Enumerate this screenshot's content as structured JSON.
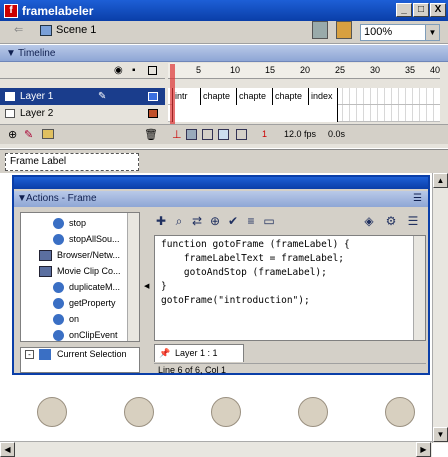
{
  "window": {
    "title": "framelabeler",
    "minimize": "_",
    "maximize": "□",
    "close": "X"
  },
  "toolbar": {
    "back": "⇐",
    "scene": "Scene 1",
    "zoom": "100%",
    "zoom_arrow": "▼"
  },
  "timeline": {
    "header": "Timeline",
    "ruler": [
      "5",
      "10",
      "15",
      "20",
      "25",
      "30",
      "35",
      "40"
    ],
    "layers": [
      {
        "name": "Layer 1"
      },
      {
        "name": "Layer 2"
      }
    ],
    "frame_labels": [
      "intr",
      "chapte",
      "chapte",
      "chapte",
      "index"
    ],
    "current_frame": "1",
    "fps": "12.0 fps",
    "time": "0.0s"
  },
  "properties": {
    "frame_label_placeholder": "Frame Label"
  },
  "actions": {
    "title": "Actions - Frame",
    "toolbox_items": [
      {
        "label": "stop",
        "kind": "action"
      },
      {
        "label": "stopAllSou...",
        "kind": "action"
      },
      {
        "label": "Browser/Netw...",
        "kind": "book"
      },
      {
        "label": "Movie Clip Co...",
        "kind": "book"
      },
      {
        "label": "duplicateM...",
        "kind": "action"
      },
      {
        "label": "getProperty",
        "kind": "action"
      },
      {
        "label": "on",
        "kind": "action"
      },
      {
        "label": "onClipEvent",
        "kind": "action"
      }
    ],
    "selection": "Current Selection",
    "code_lines": [
      {
        "t": "function gotoFrame (frameLabel) {"
      },
      {
        "t": "    frameLabelText = frameLabel;"
      },
      {
        "t": "    gotoAndStop (frameLabel);"
      },
      {
        "t": "}"
      },
      {
        "t": "gotoFrame(\"introduction\");"
      }
    ],
    "tab": "Layer 1 : 1",
    "status": "Line 6 of 6, Col 1"
  }
}
